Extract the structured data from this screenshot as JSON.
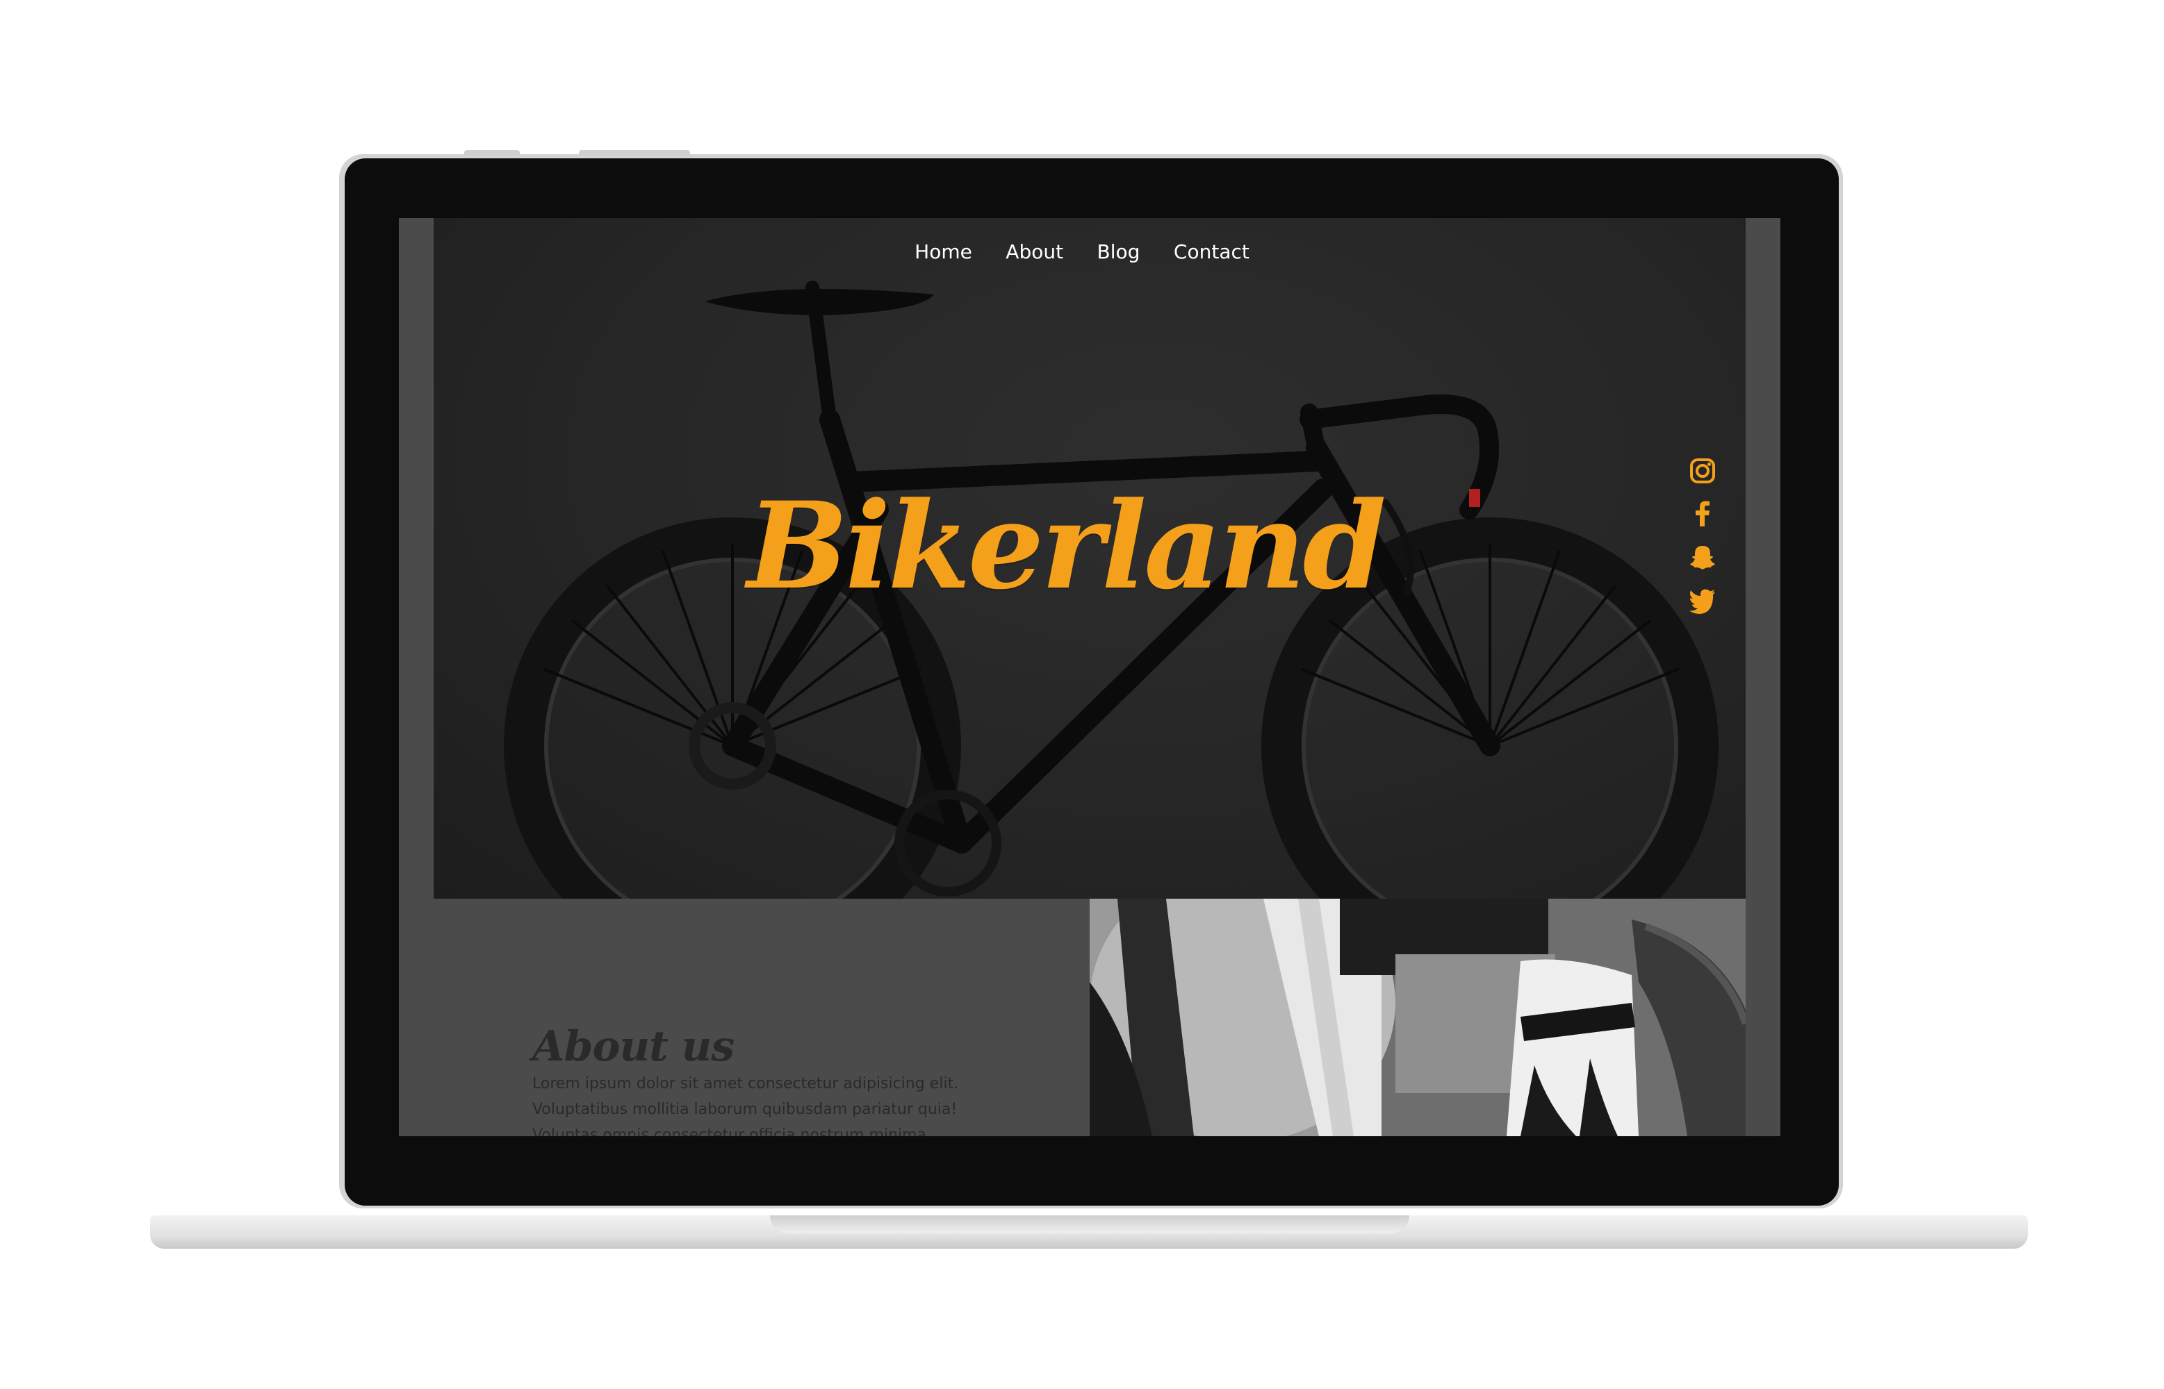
{
  "nav": {
    "items": [
      {
        "label": "Home"
      },
      {
        "label": "About"
      },
      {
        "label": "Blog"
      },
      {
        "label": "Contact"
      }
    ]
  },
  "hero": {
    "title": "Bikerland"
  },
  "social": {
    "icons": [
      "instagram-icon",
      "facebook-icon",
      "snapchat-icon",
      "twitter-icon"
    ],
    "color": "#f5a01a"
  },
  "about": {
    "heading": "About us",
    "text": "Lorem ipsum dolor sit amet consectetur adipisicing elit. Voluptatibus mollitia laborum quibusdam pariatur quia! Voluptas omnis consectetur officia nostrum minima excepturi, perferendis"
  },
  "colors": {
    "accent": "#f5a01a",
    "panel": "#4b4b4b",
    "hero_bg": "#262626"
  }
}
